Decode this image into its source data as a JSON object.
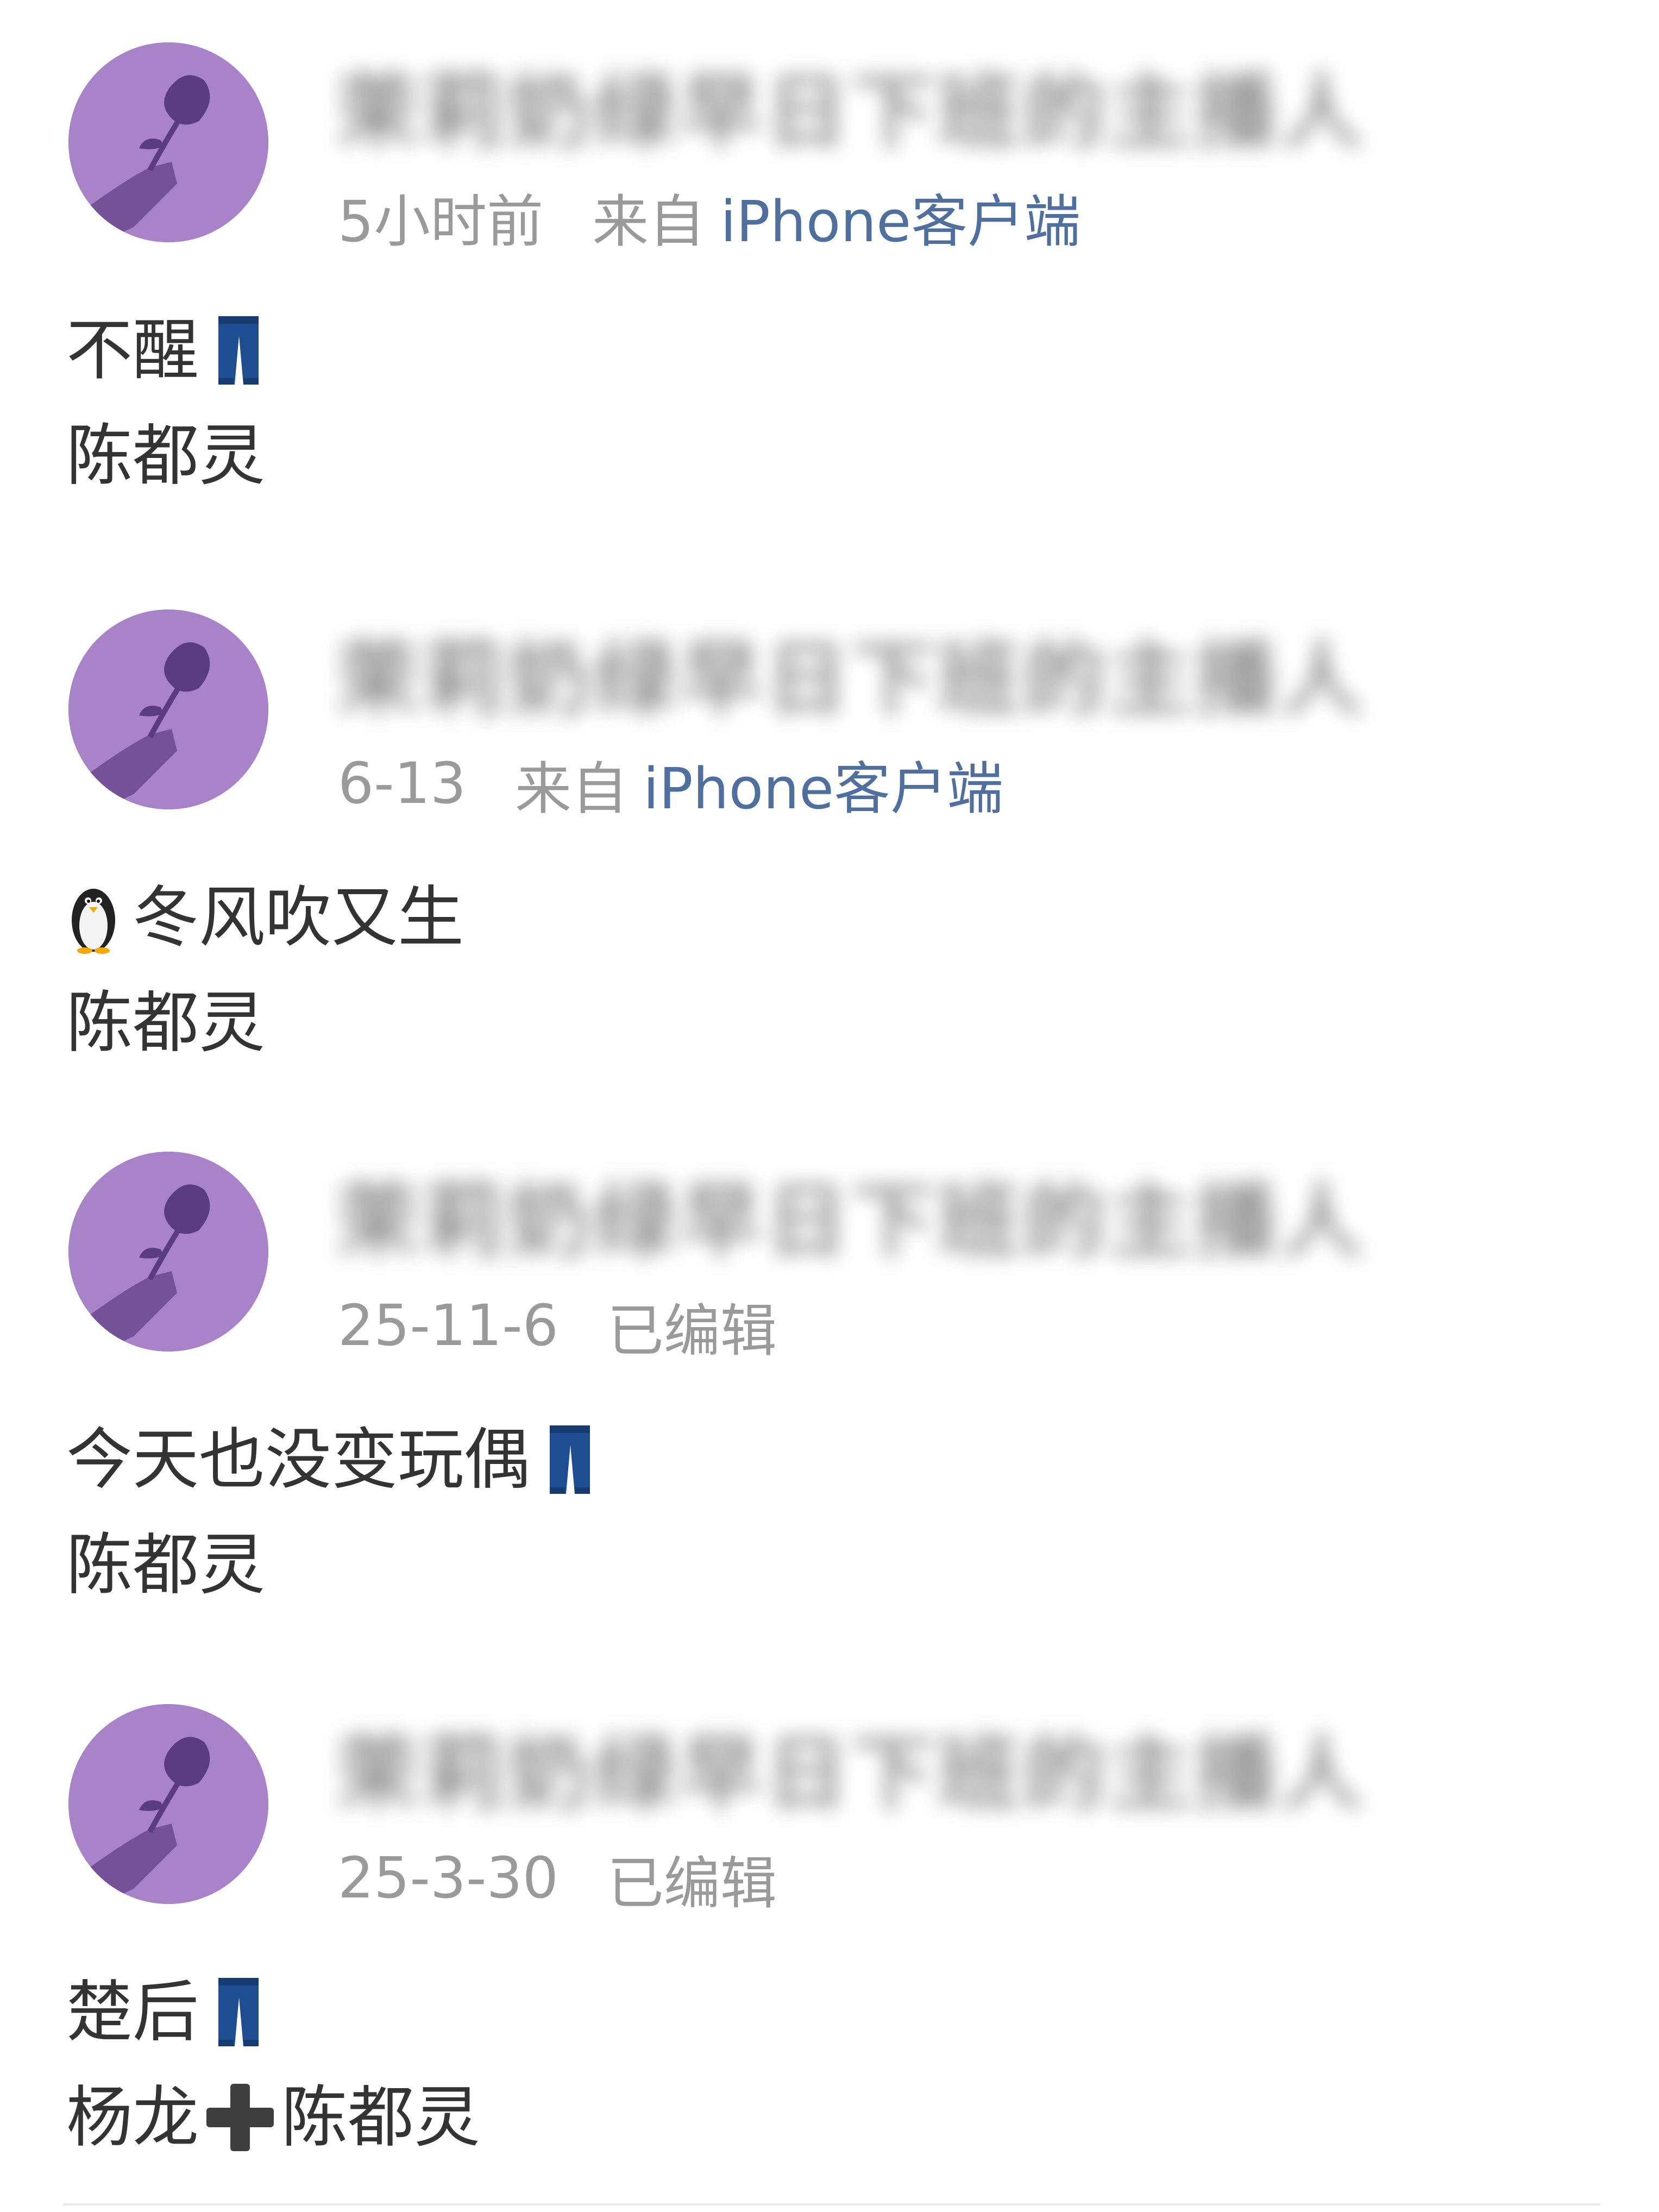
{
  "posts": [
    {
      "username": "茉莉奶绿早日下班的主播人",
      "time": "5小时前",
      "source_prefix": "来自",
      "source_client": "iPhone客户端",
      "edited": "",
      "lines": [
        "不醒",
        "陈都灵"
      ],
      "emojis": [
        "jeans-icon"
      ]
    },
    {
      "username": "茉莉奶绿早日下班的主播人",
      "time": "6-13",
      "source_prefix": "来自",
      "source_client": "iPhone客户端",
      "edited": "",
      "lines": [
        "冬风吹又生",
        "陈都灵"
      ],
      "emojis": [
        "penguin-icon"
      ]
    },
    {
      "username": "茉莉奶绿早日下班的主播人",
      "time": "25-11-6",
      "source_prefix": "",
      "source_client": "",
      "edited": "已编辑",
      "lines": [
        "今天也没变玩偶",
        "陈都灵"
      ],
      "emojis": [
        "jeans-icon"
      ]
    },
    {
      "username": "茉莉奶绿早日下班的主播人",
      "time": "25-3-30",
      "source_prefix": "",
      "source_client": "",
      "edited": "已编辑",
      "lines": [
        "楚后",
        "杨龙",
        "陈都灵"
      ],
      "emojis": [
        "jeans-icon",
        "plus-icon"
      ]
    }
  ],
  "colors": {
    "avatar_bg": "#a883c9",
    "client_link": "#4f6f9e",
    "meta_gray": "#9a9a9a",
    "text": "#333333"
  }
}
